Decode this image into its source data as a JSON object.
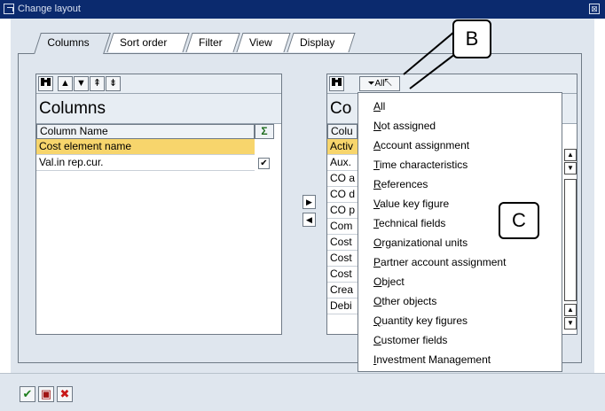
{
  "window": {
    "title": "Change layout",
    "close_glyph": "⊠"
  },
  "tabs": [
    {
      "label": "Columns"
    },
    {
      "label": "Sort order"
    },
    {
      "label": "Filter"
    },
    {
      "label": "View"
    },
    {
      "label": "Display"
    }
  ],
  "left_panel": {
    "title": "Columns",
    "column_header": "Column Name",
    "sum_icon": "Σ",
    "rows": [
      {
        "name": "Cost element name",
        "selected": true
      },
      {
        "name": "Val.in rep.cur.",
        "checked": true
      }
    ],
    "toolbar_icons": [
      "binoculars-icon",
      "arrow-up-icon",
      "arrow-down-icon",
      "arrow-top-icon",
      "arrow-bottom-icon"
    ]
  },
  "right_panel": {
    "title": "Co",
    "column_header": "Colu",
    "rows": [
      "Activ",
      "Aux.",
      "CO a",
      "CO d",
      "CO p",
      "Com",
      "Cost",
      "Cost",
      "Cost",
      "Crea",
      "Debi"
    ],
    "filter_button_label": "All"
  },
  "filter_menu": {
    "items": [
      "All",
      "Not assigned",
      "Account assignment",
      "Time characteristics",
      "References",
      "Value key figure",
      "Technical fields",
      "Organizational units",
      "Partner account assignment",
      "Object",
      "Other objects",
      "Quantity key figures",
      "Customer fields",
      "Investment Management"
    ]
  },
  "callouts": {
    "b": "B",
    "c": "C"
  },
  "footer": {
    "buttons": [
      "check-icon",
      "save-icon",
      "cancel-icon"
    ]
  },
  "colors": {
    "titlebar": "#0b2a6e",
    "selection": "#f7d56c",
    "background": "#dfe6ee"
  }
}
